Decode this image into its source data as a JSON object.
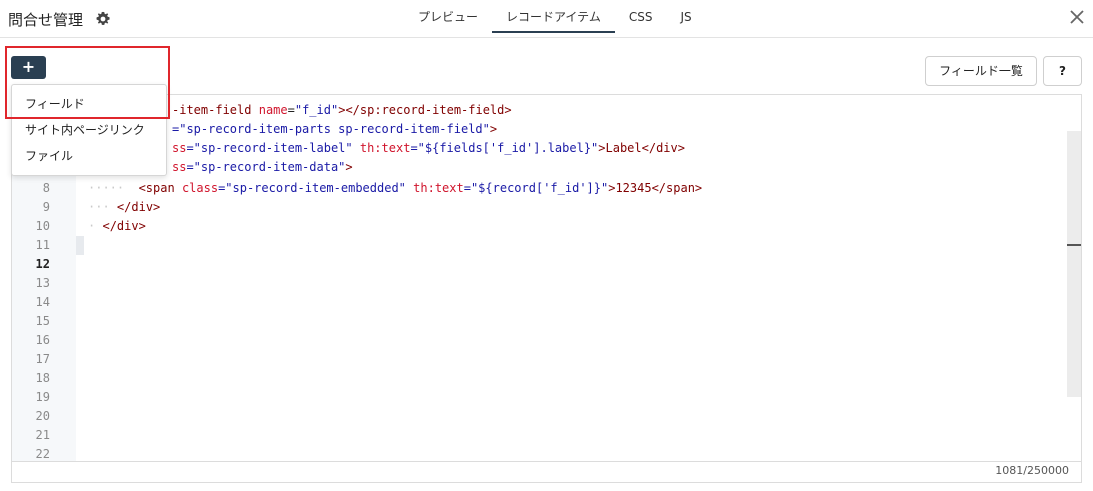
{
  "header": {
    "title": "問合せ管理",
    "tabs": [
      {
        "label": "プレビュー",
        "active": false
      },
      {
        "label": "レコードアイテム",
        "active": true
      },
      {
        "label": "CSS",
        "active": false
      },
      {
        "label": "JS",
        "active": false
      }
    ]
  },
  "toolbar": {
    "add_label": "+",
    "fields_button": "フィールド一覧",
    "help_button": "?"
  },
  "dropdown": {
    "items": [
      "フィールド",
      "サイト内ページリンク",
      "ファイル"
    ]
  },
  "editor": {
    "line_numbers": [
      "8",
      "9",
      "10",
      "11",
      "12",
      "13",
      "14",
      "15",
      "16",
      "17",
      "18",
      "19",
      "20",
      "21",
      "22"
    ],
    "current_line": "12",
    "lines": [
      {
        "t1": "-item-field",
        "a1": "name",
        "v1": "\"f_id\"",
        "t2": "></sp:record-item-field>"
      },
      {
        "v1": "=\"sp-record-item-parts sp-record-item-field\"",
        "t2": ">"
      },
      {
        "a0": "ss",
        "v1": "=\"sp-record-item-label\"",
        "a1": "th:text",
        "v2": "=\"${fields['f_id'].label}\"",
        "t2": ">Label</div>"
      },
      {
        "a0": "ss",
        "v1": "=\"sp-record-item-data\"",
        "t2": ">"
      },
      {
        "t1": "<span",
        "a1": "class",
        "v1": "=\"sp-record-item-embedded\"",
        "a2": "th:text",
        "v2": "=\"${record['f_id']}\"",
        "t2": ">12345</span>"
      },
      {
        "t1": "</div>"
      },
      {
        "t1": "</div>"
      }
    ]
  },
  "footer": {
    "counter": "1081/250000"
  },
  "colors": {
    "primary": "#2a3f52",
    "highlight": "#e0262c",
    "tag": "#800000",
    "attr": "#d0142c",
    "value": "#1a1aa6"
  },
  "icons": [
    "gear-icon",
    "close-icon",
    "plus-icon"
  ]
}
